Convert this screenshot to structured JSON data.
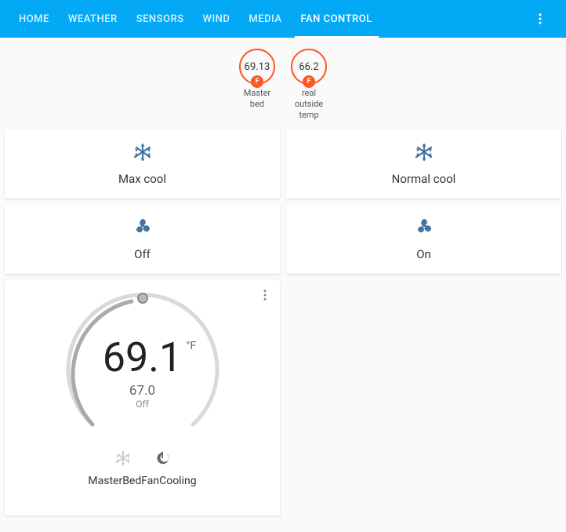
{
  "tabs": [
    {
      "label": "HOME"
    },
    {
      "label": "WEATHER"
    },
    {
      "label": "SENSORS"
    },
    {
      "label": "WIND"
    },
    {
      "label": "MEDIA"
    },
    {
      "label": "FAN CONTROL"
    }
  ],
  "activeTabIndex": 5,
  "sensors": [
    {
      "value": "69.13",
      "unit": "F",
      "label": "Master bed"
    },
    {
      "value": "66.2",
      "unit": "F",
      "label": "real outside temp"
    }
  ],
  "buttons": [
    {
      "icon": "snowflake",
      "label": "Max cool"
    },
    {
      "icon": "snowflake",
      "label": "Normal cool"
    },
    {
      "icon": "fan",
      "label": "Off"
    },
    {
      "icon": "fan",
      "label": "On"
    }
  ],
  "thermostat": {
    "current": "69.1",
    "unit": "°F",
    "setpoint": "67.0",
    "state": "Off",
    "name": "MasterBedFanCooling"
  },
  "colors": {
    "primary": "#03a9f4",
    "accent": "#ff5722",
    "iconBlue": "#44739e"
  }
}
